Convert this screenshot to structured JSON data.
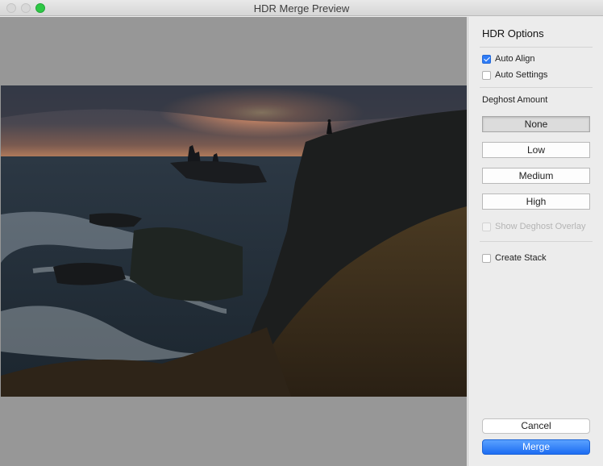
{
  "window": {
    "title": "HDR Merge Preview"
  },
  "panel": {
    "title": "HDR Options",
    "auto_align_label": "Auto Align",
    "auto_align_checked": true,
    "auto_settings_label": "Auto Settings",
    "auto_settings_checked": false,
    "deghost_label": "Deghost Amount",
    "deghost_options": [
      "None",
      "Low",
      "Medium",
      "High"
    ],
    "deghost_selected": "None",
    "show_overlay_label": "Show Deghost Overlay",
    "show_overlay_enabled": false,
    "create_stack_label": "Create Stack",
    "create_stack_checked": false,
    "cancel_label": "Cancel",
    "merge_label": "Merge"
  },
  "colors": {
    "accent": "#2f7cf6",
    "zoom_button": "#2ec845",
    "preview_background": "#979797"
  }
}
